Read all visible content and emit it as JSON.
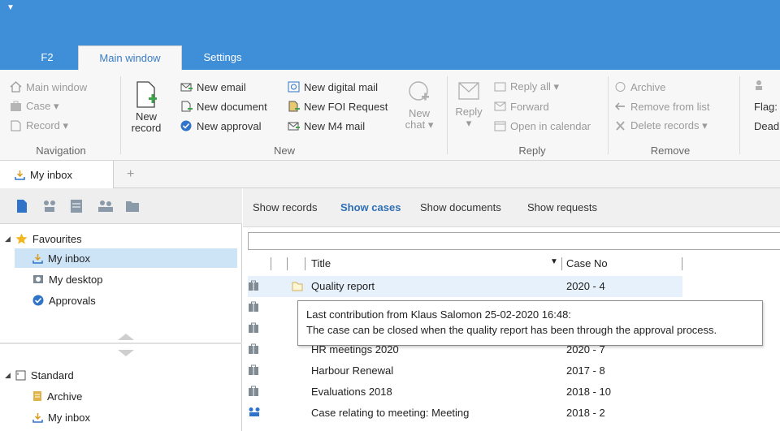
{
  "ribbon_tabs": [
    "F2",
    "Main window",
    "Settings"
  ],
  "navigation": {
    "items": [
      "Main window",
      "Case ▾",
      "Record ▾"
    ],
    "label": "Navigation"
  },
  "new_group": {
    "new_record": [
      "New",
      "record"
    ],
    "col1": [
      "New email",
      "New document",
      "New approval"
    ],
    "col2": [
      "New digital mail",
      "New FOI Request",
      "New M4 mail"
    ],
    "new_chat": [
      "New",
      "chat ▾"
    ],
    "label": "New"
  },
  "reply_group": {
    "reply": [
      "Reply",
      "▾"
    ],
    "items": [
      "Reply all ▾",
      "Forward",
      "Open in calendar"
    ],
    "label": "Reply"
  },
  "remove_group": {
    "items": [
      "Archive",
      "Remove from list",
      "Delete records ▾"
    ],
    "label": "Remove"
  },
  "flag_group": {
    "items": [
      "Flag:",
      "Dead"
    ]
  },
  "doc_tab": {
    "label": "My inbox",
    "add": "+"
  },
  "tree": {
    "favourites": "Favourites",
    "fav_items": [
      "My inbox",
      "My desktop",
      "Approvals"
    ],
    "standard": "Standard",
    "std_items": [
      "Archive",
      "My inbox"
    ]
  },
  "show_links": [
    "Show records",
    "Show cases",
    "Show documents",
    "Show requests"
  ],
  "table": {
    "headers": {
      "title": "Title",
      "case_no": "Case No",
      "sort": "▼"
    },
    "rows": [
      {
        "title": "Quality report",
        "case_no": "2020 - 4"
      },
      {
        "title": "",
        "case_no": ""
      },
      {
        "title": "",
        "case_no": ""
      },
      {
        "title": "HR meetings 2020",
        "case_no": "2020 - 7"
      },
      {
        "title": "Harbour Renewal",
        "case_no": "2017 - 8"
      },
      {
        "title": "Evaluations 2018",
        "case_no": "2018 - 10"
      },
      {
        "title": "Case relating to meeting: Meeting",
        "case_no": "2018 - 2"
      }
    ]
  },
  "tooltip": {
    "line1": "Last contribution from Klaus Salomon 25-02-2020 16:48:",
    "line2": "The case can be closed when the quality report has been through the approval process."
  },
  "colors": {
    "titlebar": "#3f8fd8",
    "accent": "#2f6fb5",
    "selection": "#cde4f7"
  }
}
